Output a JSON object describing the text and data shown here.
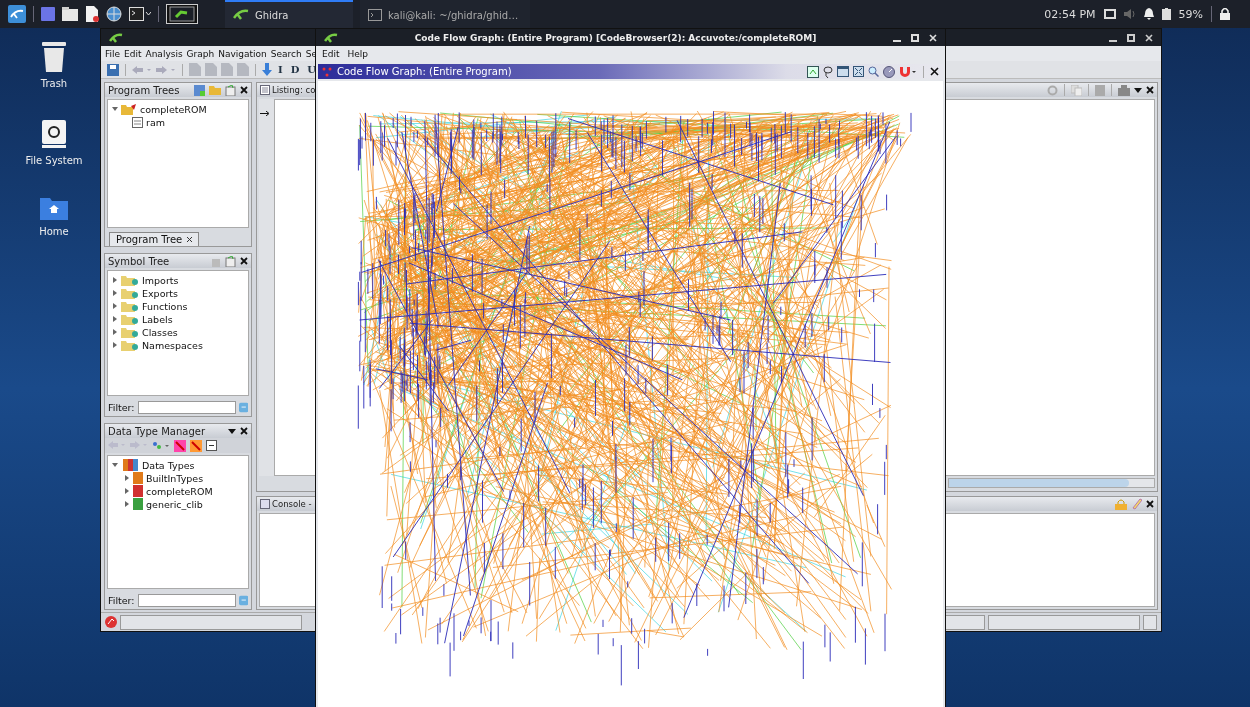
{
  "taskbar": {
    "tasks": [
      {
        "label": "Ghidra",
        "selected": true
      },
      {
        "label": "kali@kali: ~/ghidra/ghid…",
        "selected": false
      }
    ],
    "clock": "02:54 PM",
    "battery": "59%"
  },
  "desktop_icons": [
    {
      "label": "Trash",
      "kind": "trash"
    },
    {
      "label": "File System",
      "kind": "drive"
    },
    {
      "label": "Home",
      "kind": "home"
    }
  ],
  "code_browser": {
    "menu": [
      "File",
      "Edit",
      "Analysis",
      "Graph",
      "Navigation",
      "Search",
      "Se"
    ],
    "toolbar_letters": [
      "I",
      "D",
      "U"
    ],
    "program_trees": {
      "title": "Program Trees",
      "tree": [
        {
          "label": "completeROM",
          "expanded": true,
          "children": [
            {
              "label": "ram"
            }
          ]
        }
      ],
      "tab": "Program Tree"
    },
    "symbol_tree": {
      "title": "Symbol Tree",
      "items": [
        {
          "label": "Imports",
          "expanded": false
        },
        {
          "label": "Exports",
          "expanded": false
        },
        {
          "label": "Functions",
          "expanded": false
        },
        {
          "label": "Labels",
          "expanded": false
        },
        {
          "label": "Classes",
          "expanded": false
        },
        {
          "label": "Namespaces",
          "expanded": false
        }
      ],
      "filter_label": "Filter:"
    },
    "data_type_manager": {
      "title": "Data Type Manager",
      "tree": [
        {
          "label": "Data Types",
          "expanded": true,
          "children": [
            {
              "label": "BuiltInTypes",
              "expanded": false,
              "color": "#e07a1a"
            },
            {
              "label": "completeROM",
              "expanded": false,
              "color": "#d03030"
            },
            {
              "label": "generic_clib",
              "expanded": false,
              "color": "#3aa040"
            }
          ]
        }
      ],
      "filter_label": "Filter:"
    },
    "listing": {
      "title": "Listing: co"
    },
    "console": {
      "title": "Console -"
    }
  },
  "graph_window": {
    "title": "Code Flow Graph: (Entire Program) [CodeBrowser(2): Accuvote:/completeROM]",
    "menu": [
      "Edit",
      "Help"
    ],
    "header": "Code Flow Graph: (Entire Program)"
  }
}
